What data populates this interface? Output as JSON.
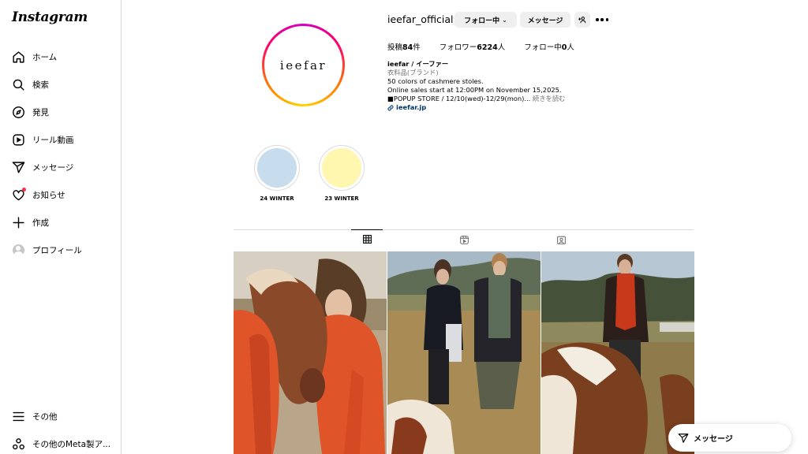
{
  "sidebar": {
    "logo": "Instagram",
    "items": [
      {
        "label": "ホーム",
        "icon": "home-icon"
      },
      {
        "label": "検索",
        "icon": "search-icon"
      },
      {
        "label": "発見",
        "icon": "compass-icon"
      },
      {
        "label": "リール動画",
        "icon": "reels-icon"
      },
      {
        "label": "メッセージ",
        "icon": "paper-plane-icon"
      },
      {
        "label": "お知らせ",
        "icon": "heart-icon"
      },
      {
        "label": "作成",
        "icon": "plus-icon"
      },
      {
        "label": "プロフィール",
        "icon": "avatar"
      }
    ],
    "bottom_items": [
      {
        "label": "その他",
        "icon": "menu-icon"
      },
      {
        "label": "その他のMeta製ア...",
        "icon": "meta-apps-icon"
      }
    ]
  },
  "profile": {
    "username": "ieefar_official",
    "avatar_text": "ieefar",
    "follow_button": "フォロー中",
    "message_button": "メッセージ",
    "stats": {
      "posts_label": "投稿",
      "posts_count": "84",
      "posts_unit": "件",
      "followers_label": "フォロワー",
      "followers_count": "6224",
      "followers_unit": "人",
      "following_label": "フォロー中",
      "following_count": "0",
      "following_unit": "人"
    },
    "bio": {
      "name": "ieefar / イーファー",
      "category": "衣料品(ブランド)",
      "line1": "50 colors of cashmere stoles.",
      "line2": "Online sales start at 12:00PM on November 15,2025.",
      "line3": "■POPUP STORE / 12/10(wed)-12/29(mon)...",
      "more": "続きを読む",
      "link": "ieefar.jp"
    }
  },
  "highlights": [
    {
      "label": "24 WINTER",
      "color": "#c7dcec"
    },
    {
      "label": "23 WINTER",
      "color": "#fff7b0"
    }
  ],
  "tabs": [
    {
      "name": "posts",
      "icon": "grid-icon",
      "active": true
    },
    {
      "name": "reels",
      "icon": "reels-icon",
      "active": false
    },
    {
      "name": "tagged",
      "icon": "tagged-icon",
      "active": false
    }
  ],
  "floating_message": {
    "label": "メッセージ"
  },
  "colors": {
    "accent_blue": "#00376b",
    "notification_red": "#ff3040",
    "button_gray": "#efefef"
  }
}
